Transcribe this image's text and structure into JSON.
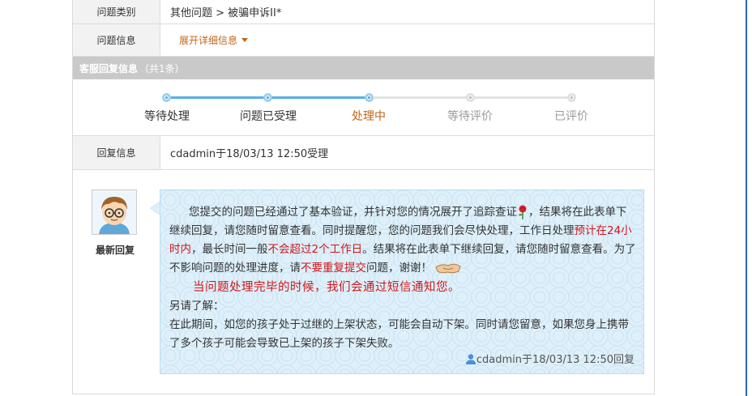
{
  "rows": {
    "category_label": "问题类别",
    "category_value": "其他问题 > 被骗申诉II*",
    "info_label": "问题信息",
    "info_expand": "展开详细信息"
  },
  "reply_section": {
    "title": "客服回复信息",
    "count": "（共1条）"
  },
  "progress": {
    "steps": [
      "等待处理",
      "问题已受理",
      "处理中",
      "等待评价",
      "已评价"
    ],
    "current_step": "处理中",
    "colors": {
      "done": "#4aa3df",
      "current_text": "#c0661a",
      "todo": "#999999"
    }
  },
  "reply_info": {
    "label": "回复信息",
    "value": "cdadmin于18/03/13 12:50受理"
  },
  "latest_reply": {
    "label": "最新回复",
    "t1": "您提交的问题已经通过了基本验证，并针对您的情况展开了追踪查证",
    "t2": "，结果将在此表单下继续回复，请您随时留意查看。同时提醒您，您的问题我们会尽快处理，工作日处理",
    "t3": "预计在24小时内",
    "t4": "，最长时间一般",
    "t5": "不会超过2个工作日",
    "t6": "。结果将在此表单下继续回复，请您随时留意查看。为了不影响问题的处理进度，请",
    "t7": "不要重复提交",
    "t8": "问题，谢谢！",
    "notice": "当问题处理完毕的时候，我们会通过短信通知您。",
    "extra_title": "另请了解：",
    "extra_body": "在此期间，如您的孩子处于过继的上架状态，可能会自动下架。同时请您留意，如果您身上携带了多个孩子可能会导致已上架的孩子下架失败。",
    "signature": "cdadmin于18/03/13 12:50回复"
  },
  "accent_colors": {
    "red": "#d0171b",
    "orange": "#c0661a",
    "bar": "#c9c9c9"
  }
}
